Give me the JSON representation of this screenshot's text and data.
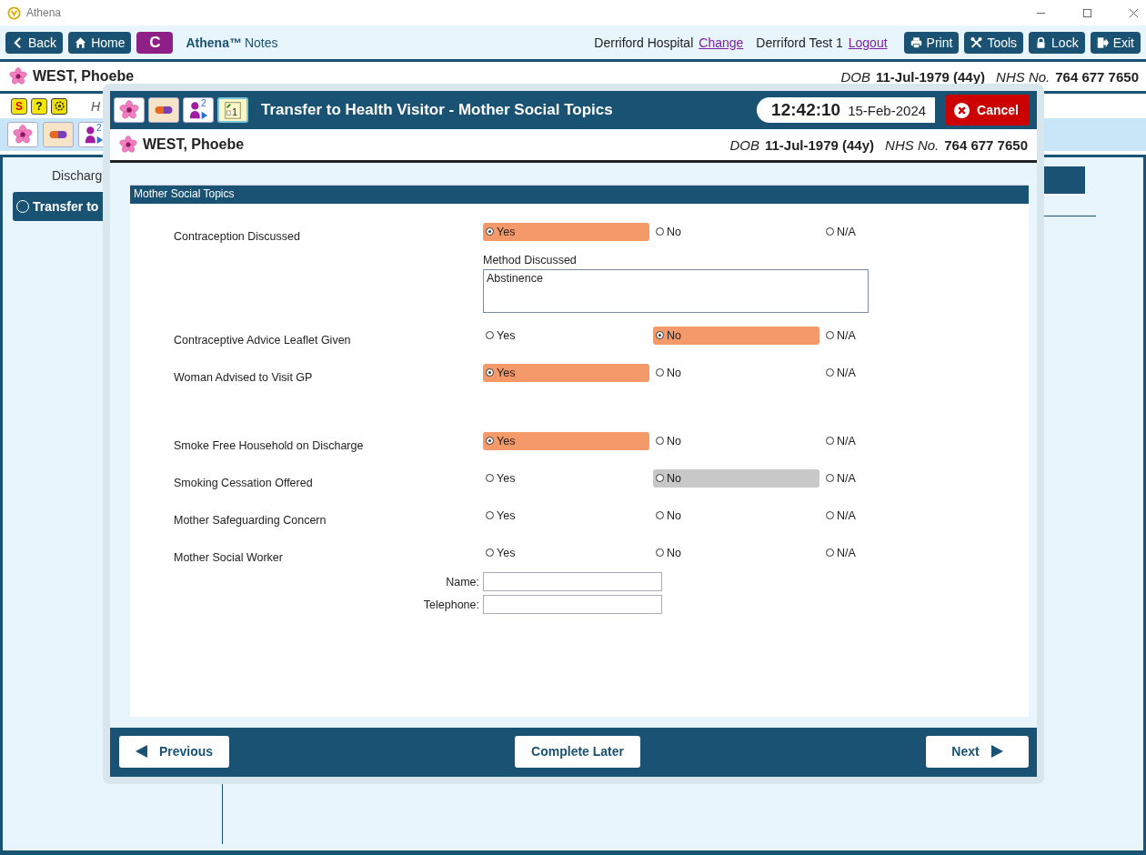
{
  "app": {
    "title": "Athena",
    "toolbar": {
      "left_buttons": [
        {
          "kind": "back",
          "label": "Back"
        },
        {
          "kind": "home",
          "label": "Home"
        },
        {
          "kind": "letter",
          "label": "C"
        }
      ],
      "brand": "Athena™",
      "brand_suffix": "Notes",
      "hospital": "Derriford Hospital",
      "change_link": "Change",
      "user": "Derriford Test 1",
      "logout_link": "Logout",
      "right_buttons": [
        {
          "kind": "print",
          "label": "Print"
        },
        {
          "kind": "tools",
          "label": "Tools"
        },
        {
          "kind": "lock",
          "label": "Lock"
        },
        {
          "kind": "exit",
          "label": "Exit"
        }
      ]
    },
    "patient": {
      "name": "WEST, Phoebe",
      "dob_label": "DOB",
      "dob": "11-Jul-1979 (44y)",
      "nhs_label": "NHS No.",
      "nhs": "764 677 7650"
    },
    "small_icons": [
      {
        "kind": "alert",
        "text": "S"
      },
      {
        "kind": "help",
        "text": "?"
      },
      {
        "kind": "settings"
      }
    ],
    "info_text": "H",
    "icon_buttons": [
      {
        "kind": "flower"
      },
      {
        "kind": "pill"
      },
      {
        "kind": "person",
        "badge": "2"
      }
    ],
    "sidebar": {
      "heading": "Discharg",
      "items": [
        {
          "label": "Transfer to",
          "selected": true
        }
      ]
    }
  },
  "modal": {
    "icon_buttons": [
      {
        "kind": "flower"
      },
      {
        "kind": "pill"
      },
      {
        "kind": "person",
        "badge": "2"
      },
      {
        "kind": "note",
        "badge": "1"
      }
    ],
    "title": "Transfer to Health Visitor - Mother Social Topics",
    "time": "12:42:10",
    "date": "15-Feb-2024",
    "cancel": "Cancel",
    "patient": {
      "name": "WEST, Phoebe",
      "dob_label": "DOB",
      "dob": "11-Jul-1979 (44y)",
      "nhs_label": "NHS No.",
      "nhs": "764 677 7650"
    },
    "section_title": "Mother Social Topics",
    "groups": [
      [
        {
          "kind": "radio",
          "label": "Contraception Discussed",
          "options": [
            {
              "label": "Yes",
              "selected": true,
              "hovered": false
            },
            {
              "label": "No",
              "selected": false,
              "hovered": false
            },
            {
              "label": "N/A",
              "selected": false,
              "hovered": false
            }
          ]
        },
        {
          "kind": "textarea",
          "label": "Method Discussed",
          "value": "Abstinence"
        },
        {
          "kind": "radio",
          "label": "Contraceptive Advice Leaflet Given",
          "options": [
            {
              "label": "Yes",
              "selected": false,
              "hovered": false
            },
            {
              "label": "No",
              "selected": true,
              "hovered": false
            },
            {
              "label": "N/A",
              "selected": false,
              "hovered": false
            }
          ]
        },
        {
          "kind": "radio",
          "label": "Woman Advised to Visit GP",
          "options": [
            {
              "label": "Yes",
              "selected": true,
              "hovered": false
            },
            {
              "label": "No",
              "selected": false,
              "hovered": false
            },
            {
              "label": "N/A",
              "selected": false,
              "hovered": false
            }
          ]
        }
      ],
      [
        {
          "kind": "radio",
          "label": "Smoke Free Household on Discharge",
          "options": [
            {
              "label": "Yes",
              "selected": true,
              "hovered": false
            },
            {
              "label": "No",
              "selected": false,
              "hovered": false
            },
            {
              "label": "N/A",
              "selected": false,
              "hovered": false
            }
          ]
        },
        {
          "kind": "radio",
          "label": "Smoking Cessation Offered",
          "options": [
            {
              "label": "Yes",
              "selected": false,
              "hovered": false
            },
            {
              "label": "No",
              "selected": false,
              "hovered": true
            },
            {
              "label": "N/A",
              "selected": false,
              "hovered": false
            }
          ]
        },
        {
          "kind": "radio",
          "label": "Mother Safeguarding Concern",
          "options": [
            {
              "label": "Yes",
              "selected": false,
              "hovered": false
            },
            {
              "label": "No",
              "selected": false,
              "hovered": false
            },
            {
              "label": "N/A",
              "selected": false,
              "hovered": false
            }
          ]
        },
        {
          "kind": "radio",
          "label": "Mother Social Worker",
          "options": [
            {
              "label": "Yes",
              "selected": false,
              "hovered": false
            },
            {
              "label": "No",
              "selected": false,
              "hovered": false
            },
            {
              "label": "N/A",
              "selected": false,
              "hovered": false
            }
          ]
        },
        {
          "kind": "text_field",
          "label": "Name:"
        },
        {
          "kind": "text_field",
          "label": "Telephone:"
        }
      ]
    ],
    "footer_buttons": [
      {
        "kind": "previous",
        "label": "Previous"
      },
      {
        "kind": "plain",
        "label": "Complete Later"
      },
      {
        "kind": "next",
        "label": "Next"
      }
    ]
  }
}
